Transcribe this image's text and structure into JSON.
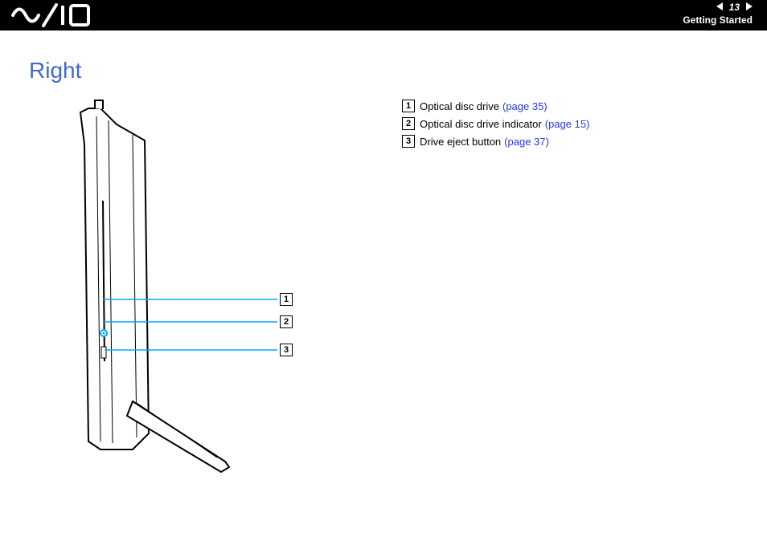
{
  "header": {
    "page_number": "13",
    "section": "Getting Started"
  },
  "section_title": "Right",
  "callouts": {
    "c1": "1",
    "c2": "2",
    "c3": "3"
  },
  "legend": [
    {
      "num": "1",
      "text": "Optical disc drive",
      "link": "(page 35)"
    },
    {
      "num": "2",
      "text": "Optical disc drive indicator",
      "link": "(page 15)"
    },
    {
      "num": "3",
      "text": "Drive eject button",
      "link": "(page 37)"
    }
  ]
}
